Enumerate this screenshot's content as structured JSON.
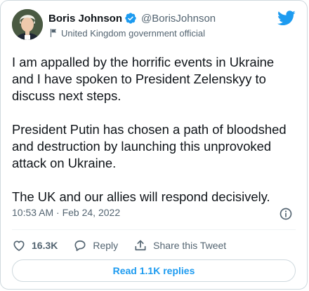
{
  "tweet": {
    "author": {
      "display_name": "Boris Johnson",
      "handle": "@BorisJohnson",
      "label": "United Kingdom government official",
      "verified": true
    },
    "paragraphs": [
      "I am appalled by the horrific events in Ukraine and I have spoken to President Zelenskyy to discuss next steps.",
      "President Putin has chosen a path of bloodshed and destruction by launching this unprovoked attack on Ukraine.",
      "The UK and our allies will respond decisively."
    ],
    "timestamp": "10:53 AM · Feb 24, 2022",
    "actions": {
      "like_count": "16.3K",
      "reply_label": "Reply",
      "share_label": "Share this Tweet"
    },
    "read_replies_label": "Read 1.1K replies"
  },
  "icons": {
    "verified": "verified-badge-icon",
    "label": "flag-icon",
    "brand": "twitter-bird-icon",
    "info": "info-icon",
    "like": "heart-icon",
    "reply": "speech-bubble-icon",
    "share": "share-upload-icon"
  },
  "colors": {
    "brand_blue": "#1d9bf0",
    "like_red": "#f91880",
    "text_primary": "#0f1419",
    "text_secondary": "#536471",
    "border": "#cfd9de"
  }
}
